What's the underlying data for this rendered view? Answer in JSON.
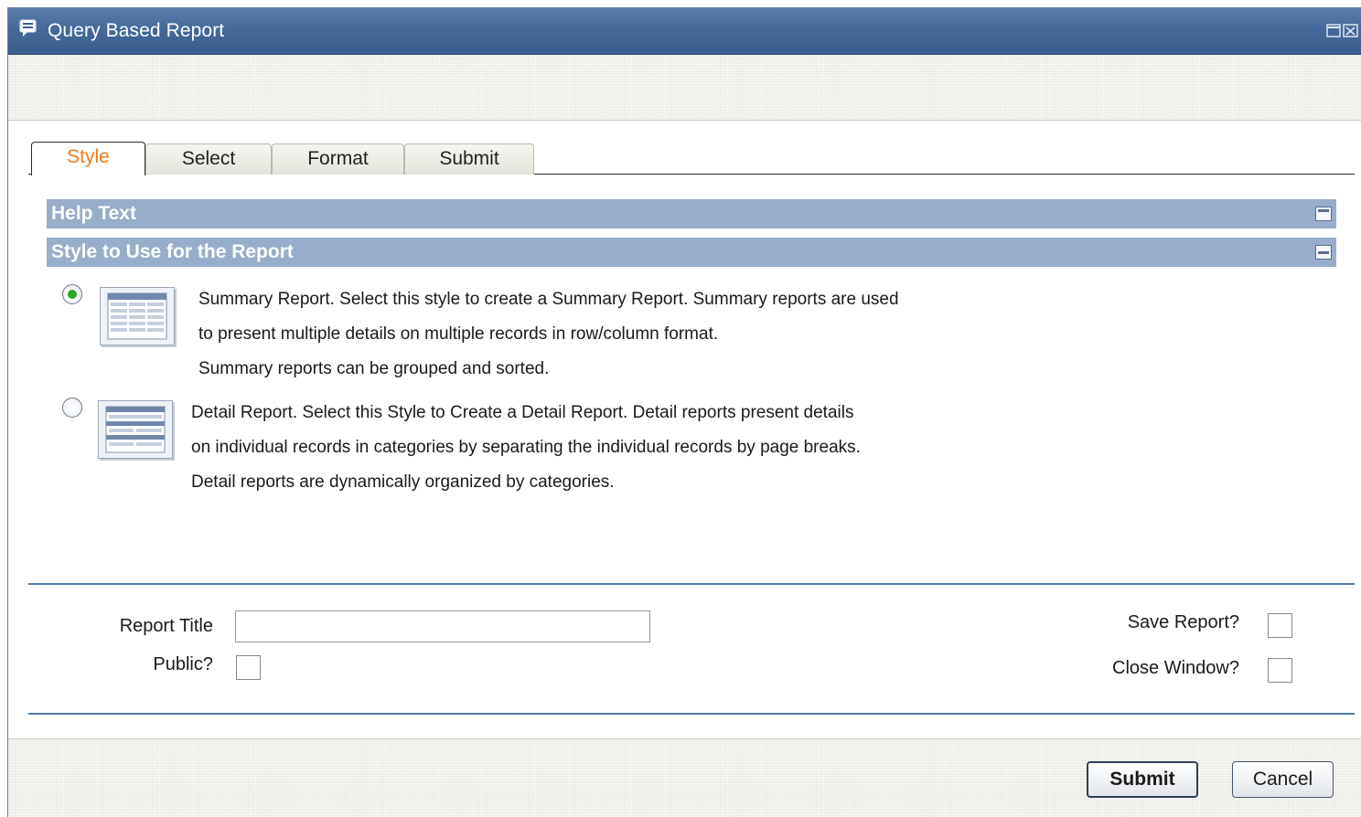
{
  "window": {
    "title": "Query Based Report",
    "icon": "report-icon",
    "controls_icon": "restore-close-icon"
  },
  "tabs": [
    {
      "label": "Style",
      "active": true
    },
    {
      "label": "Select",
      "active": false
    },
    {
      "label": "Format",
      "active": false
    },
    {
      "label": "Submit",
      "active": false
    }
  ],
  "sections": {
    "help": {
      "title": "Help Text",
      "icon": "maximize-icon"
    },
    "style": {
      "title": "Style to Use for the Report",
      "icon": "minimize-icon"
    }
  },
  "styles": [
    {
      "selected": true,
      "icon": "summary-report-icon",
      "lines": [
        "Summary Report. Select this style to create a Summary Report. Summary reports are used",
        "to present multiple details on multiple records in row/column format.",
        "Summary reports can be grouped and sorted."
      ]
    },
    {
      "selected": false,
      "icon": "detail-report-icon",
      "lines": [
        "Detail Report. Select this Style to Create a Detail Report. Detail reports present details",
        "on individual records in categories by separating the individual records by page breaks.",
        "Detail reports are dynamically organized by categories."
      ]
    }
  ],
  "form": {
    "report_title_label": "Report Title",
    "report_title_value": "",
    "public_label": "Public?",
    "public_checked": false,
    "save_label": "Save Report?",
    "save_checked": false,
    "close_label": "Close Window?",
    "close_checked": false
  },
  "buttons": {
    "submit": "Submit",
    "cancel": "Cancel"
  },
  "colors": {
    "titlebar": "#46699b",
    "section_bar": "#97adc9",
    "active_tab_text": "#f07a18",
    "radio_dot": "#2fa52a"
  }
}
